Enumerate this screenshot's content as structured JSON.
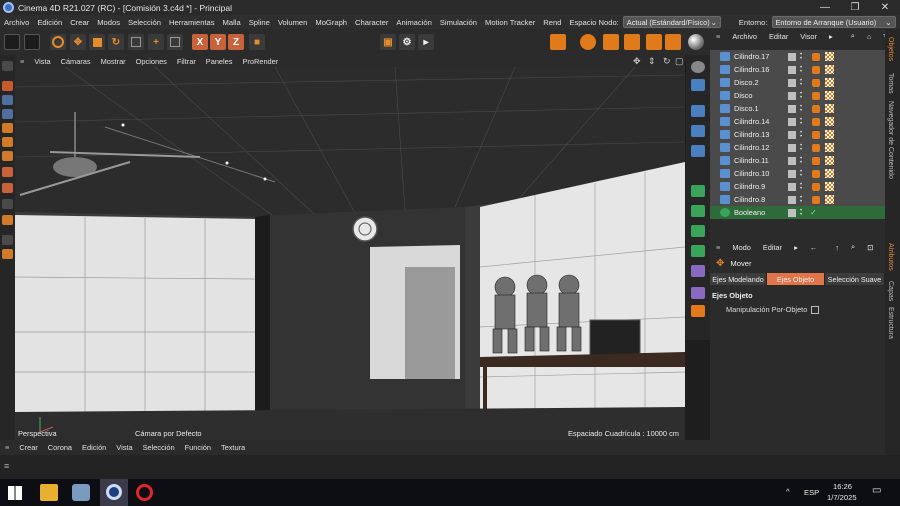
{
  "window": {
    "title": "Cinema 4D R21.027 (RC) - [Comisión 3.c4d *] - Principal",
    "controls": {
      "minimize": "—",
      "maximize": "❐",
      "close": "✕"
    }
  },
  "menubar": {
    "items": [
      "Archivo",
      "Edición",
      "Crear",
      "Modos",
      "Selección",
      "Herramientas",
      "Malla",
      "Spline",
      "Volumen",
      "MoGraph",
      "Character",
      "Animación",
      "Simulación",
      "Motion Tracker",
      "Rend"
    ],
    "node_space_label": "Espacio Nodo:",
    "node_space_value": "Actual (Estándard/Físico)",
    "environment_label": "Entorno:",
    "environment_value": "Entorno de Arranque (Usuario)"
  },
  "toolbar": {
    "axis_x": "X",
    "axis_y": "Y",
    "axis_z": "Z"
  },
  "viewport": {
    "menu": [
      "Vista",
      "Cámaras",
      "Mostrar",
      "Opciones",
      "Filtrar",
      "Paneles",
      "ProRender"
    ],
    "view_name": "Perspectiva",
    "camera_label": "Cámara por Defecto",
    "grid_spacing": "Espaciado Cuadrícula : 10000 cm"
  },
  "object_manager": {
    "menu": [
      "Archivo",
      "Editar",
      "Visor"
    ],
    "objects": [
      {
        "name": "Cilindro.17",
        "type": "cylinder"
      },
      {
        "name": "Cilindro.16",
        "type": "cylinder"
      },
      {
        "name": "Disco.2",
        "type": "disc"
      },
      {
        "name": "Disco",
        "type": "disc"
      },
      {
        "name": "Disco.1",
        "type": "disc"
      },
      {
        "name": "Cilindro.14",
        "type": "cylinder"
      },
      {
        "name": "Cilindro.13",
        "type": "cylinder"
      },
      {
        "name": "Cilindro.12",
        "type": "cylinder"
      },
      {
        "name": "Cilindro.11",
        "type": "cylinder"
      },
      {
        "name": "Cilindro.10",
        "type": "cylinder"
      },
      {
        "name": "Cilindro.9",
        "type": "cylinder"
      },
      {
        "name": "Cilindro.8",
        "type": "cylinder"
      },
      {
        "name": "Booleano",
        "type": "boolean"
      }
    ]
  },
  "attributes": {
    "menu": [
      "Modo",
      "Editar"
    ],
    "tool_name": "Mover",
    "tabs": [
      "Ejes Modelando",
      "Ejes Objeto",
      "Selección Suave"
    ],
    "active_tab": "Ejes Objeto",
    "section_title": "Ejes Objeto",
    "option_label": "Manipulación Por-Objeto"
  },
  "side_tabs": [
    "Objetos",
    "Tomas",
    "Navegador de Contenido",
    "Atributos",
    "Capas",
    "Estructura"
  ],
  "timeline": {
    "menu": [
      "Crear",
      "Corona",
      "Edición",
      "Vista",
      "Selección",
      "Función",
      "Textura"
    ]
  },
  "taskbar": {
    "language": "ESP",
    "time": "16:26",
    "date": "1/7/2025",
    "up_arrow": "^",
    "notification": "▭"
  },
  "colors": {
    "accent": "#e07a1a",
    "selected_tab": "#e0744a",
    "object_row": "#4a4a4a",
    "object_selected": "#2f6b3a"
  }
}
